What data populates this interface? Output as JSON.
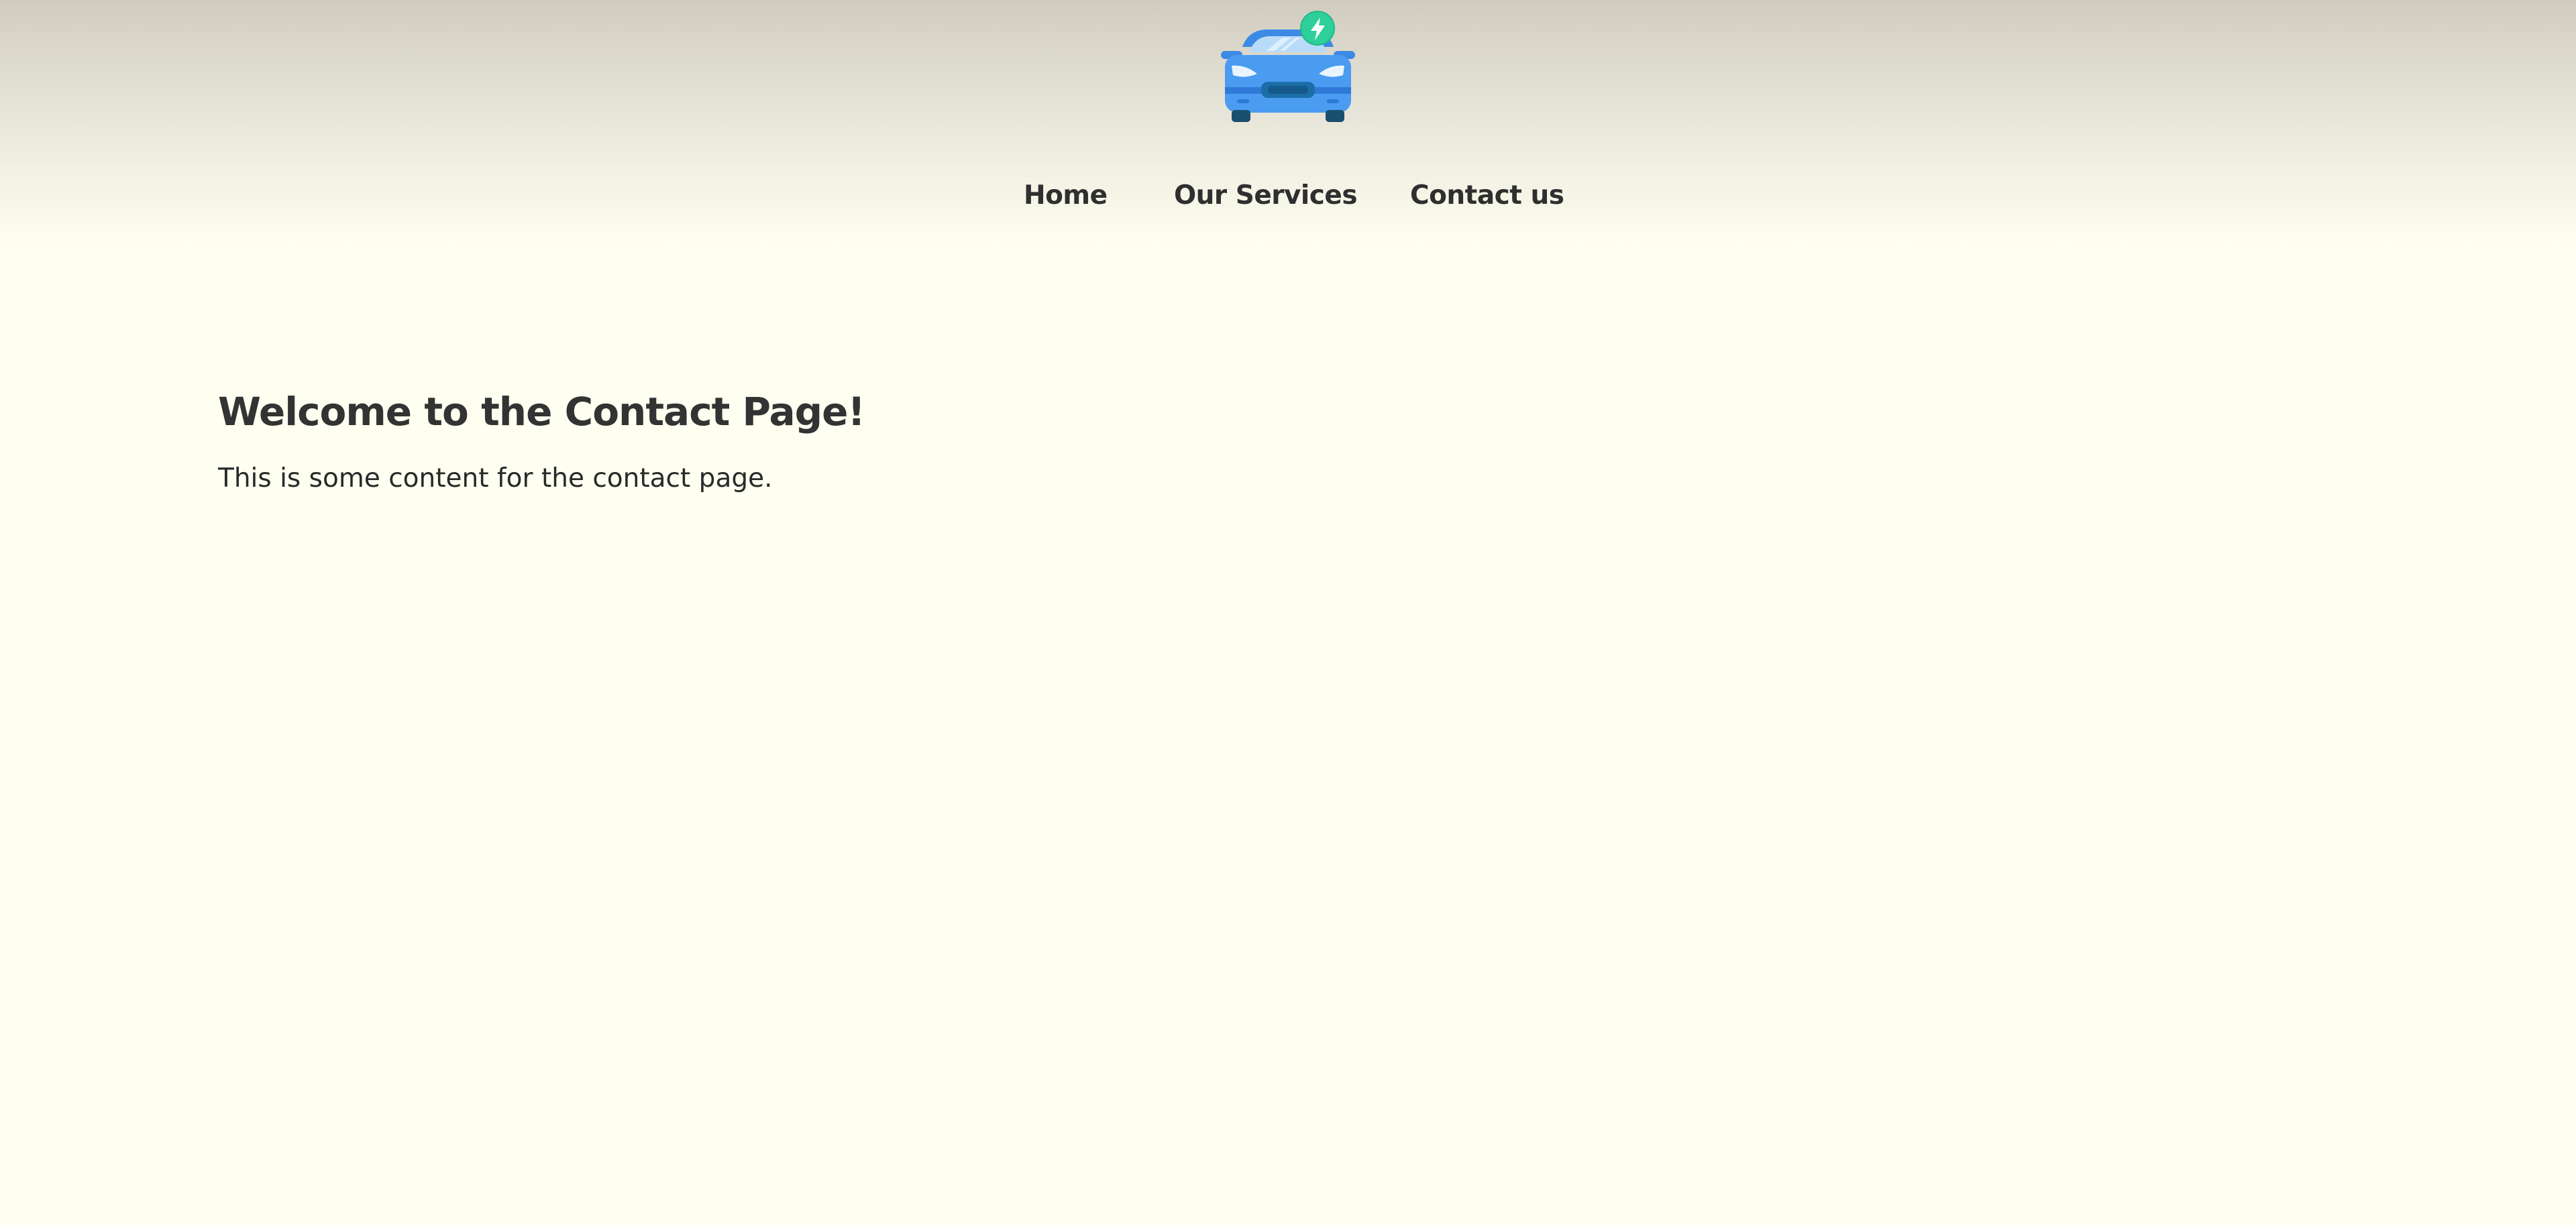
{
  "header": {
    "logo": {
      "icon": "electric-car-icon",
      "colors": {
        "car_body": "#4a9cf0",
        "car_roof": "#3d8ae6",
        "windshield": "#b8dcf8",
        "tires": "#1b4f6f",
        "charge_badge": "#2ecf9a",
        "bolt": "#ffffff"
      }
    },
    "nav": {
      "items": [
        {
          "label": "Home"
        },
        {
          "label": "Our Services"
        },
        {
          "label": "Contact us"
        }
      ]
    }
  },
  "main": {
    "title": "Welcome to the Contact Page!",
    "body_text": "This is some content for the contact page."
  },
  "colors": {
    "page_background": "#fefff0",
    "header_gradient_top": "#d0ccbf",
    "text": "#2f2f2f"
  }
}
